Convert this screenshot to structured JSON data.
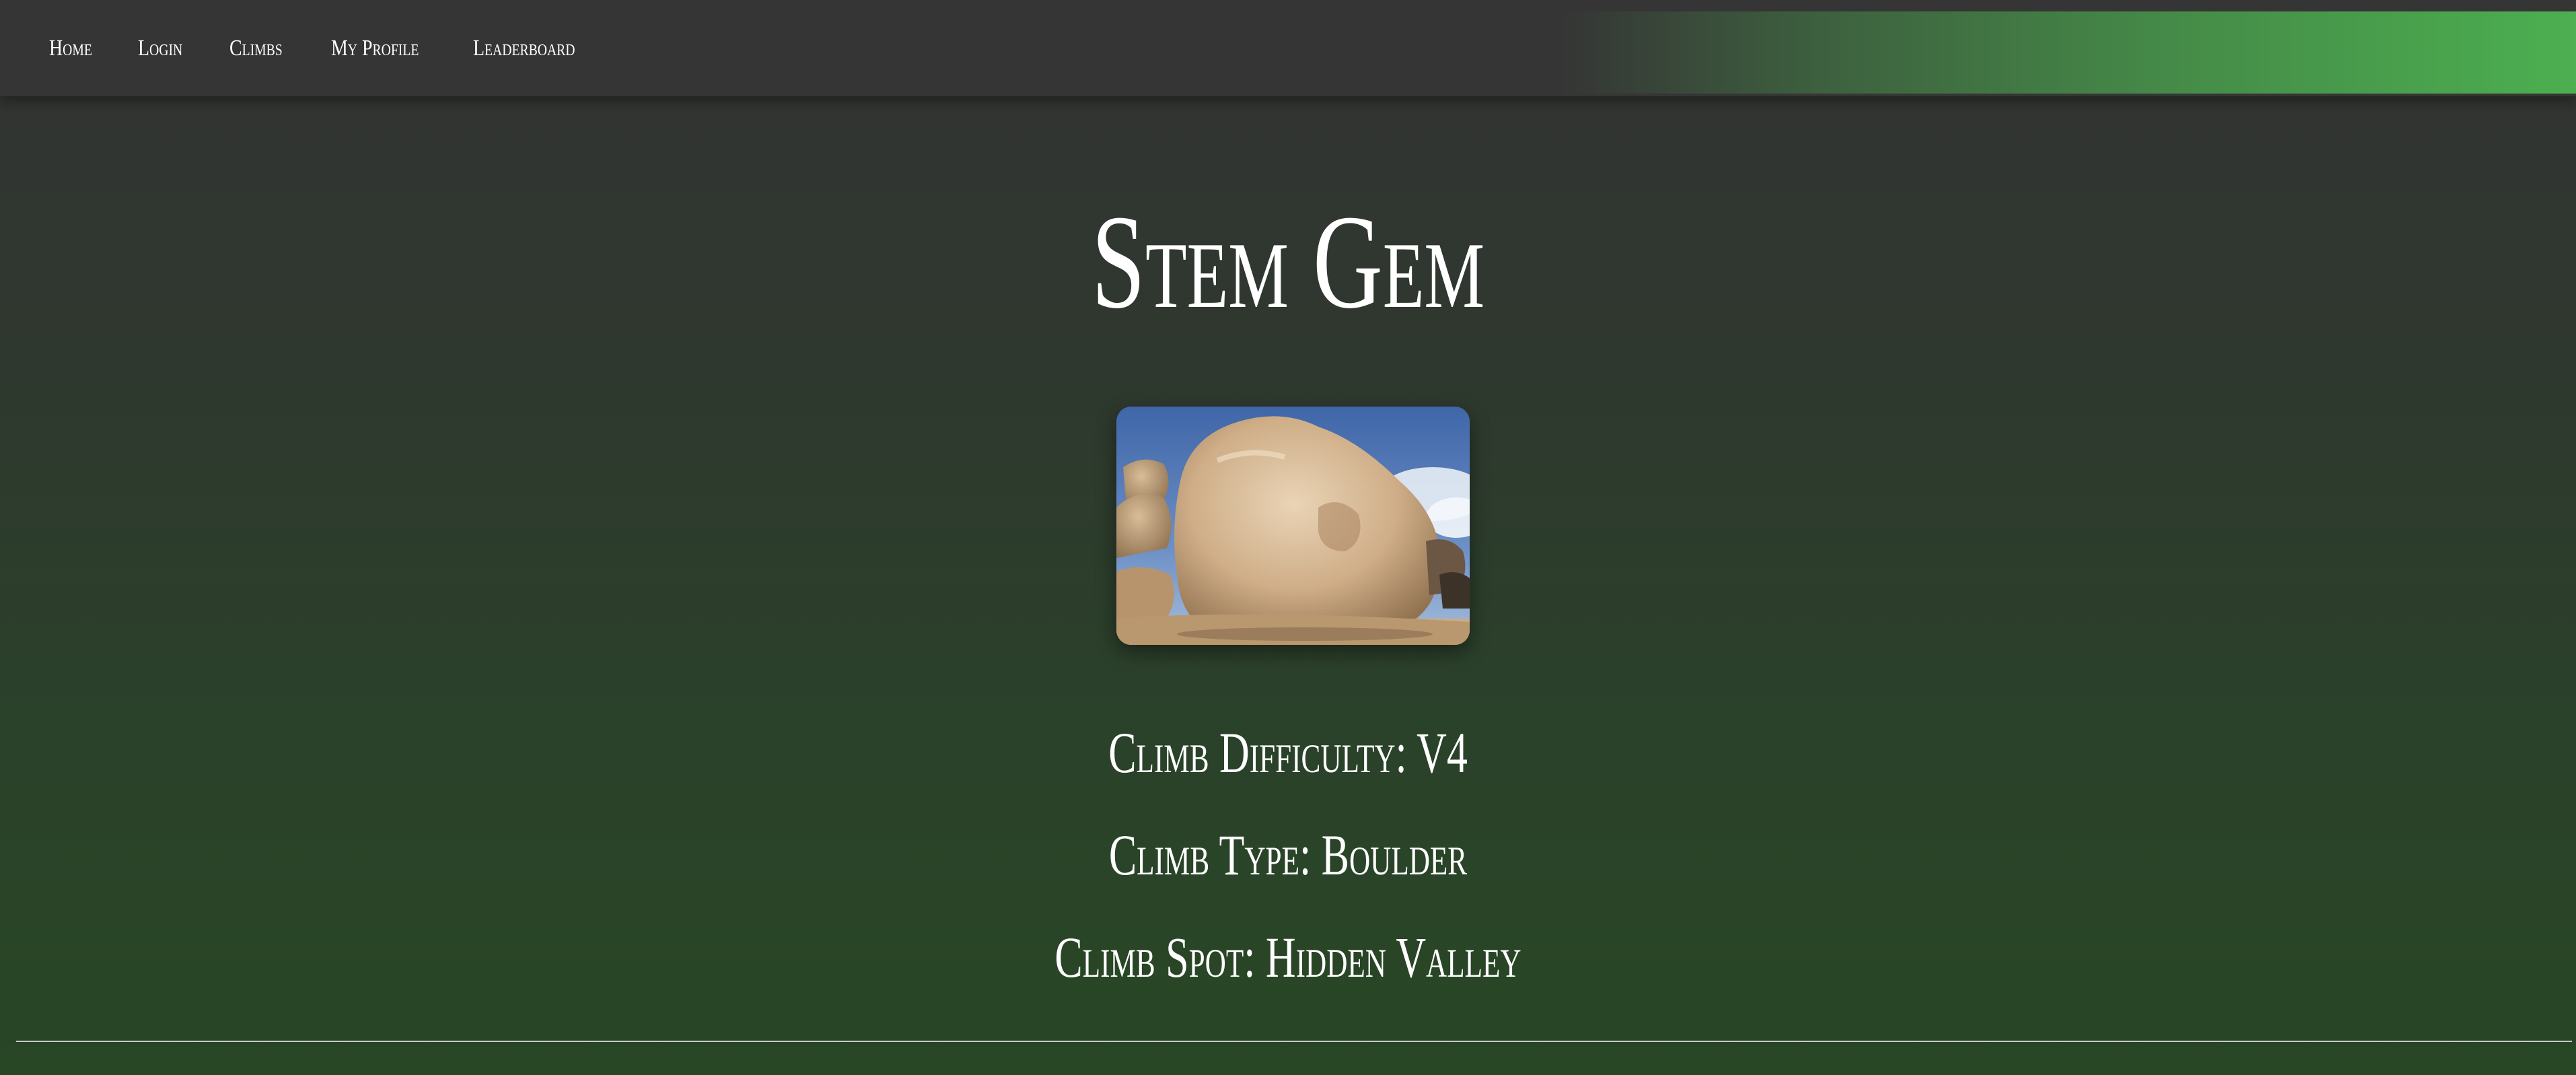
{
  "nav": {
    "items": [
      {
        "label": "Home"
      },
      {
        "label": "Login"
      },
      {
        "label": "Climbs"
      },
      {
        "label": "My Profile"
      },
      {
        "label": "Leaderboard"
      }
    ],
    "accent_color": "#4caf50"
  },
  "climb": {
    "name": "Stem Gem",
    "image_icon": "boulder-photo",
    "difficulty_text": "Climb Difficulty: V4",
    "type_text": "Climb Type: Boulder",
    "spot_text": "Climb Spot: Hidden Valley"
  },
  "colors": {
    "background_top": "#333333",
    "background_bottom": "#284725",
    "navbar": "#353535"
  }
}
